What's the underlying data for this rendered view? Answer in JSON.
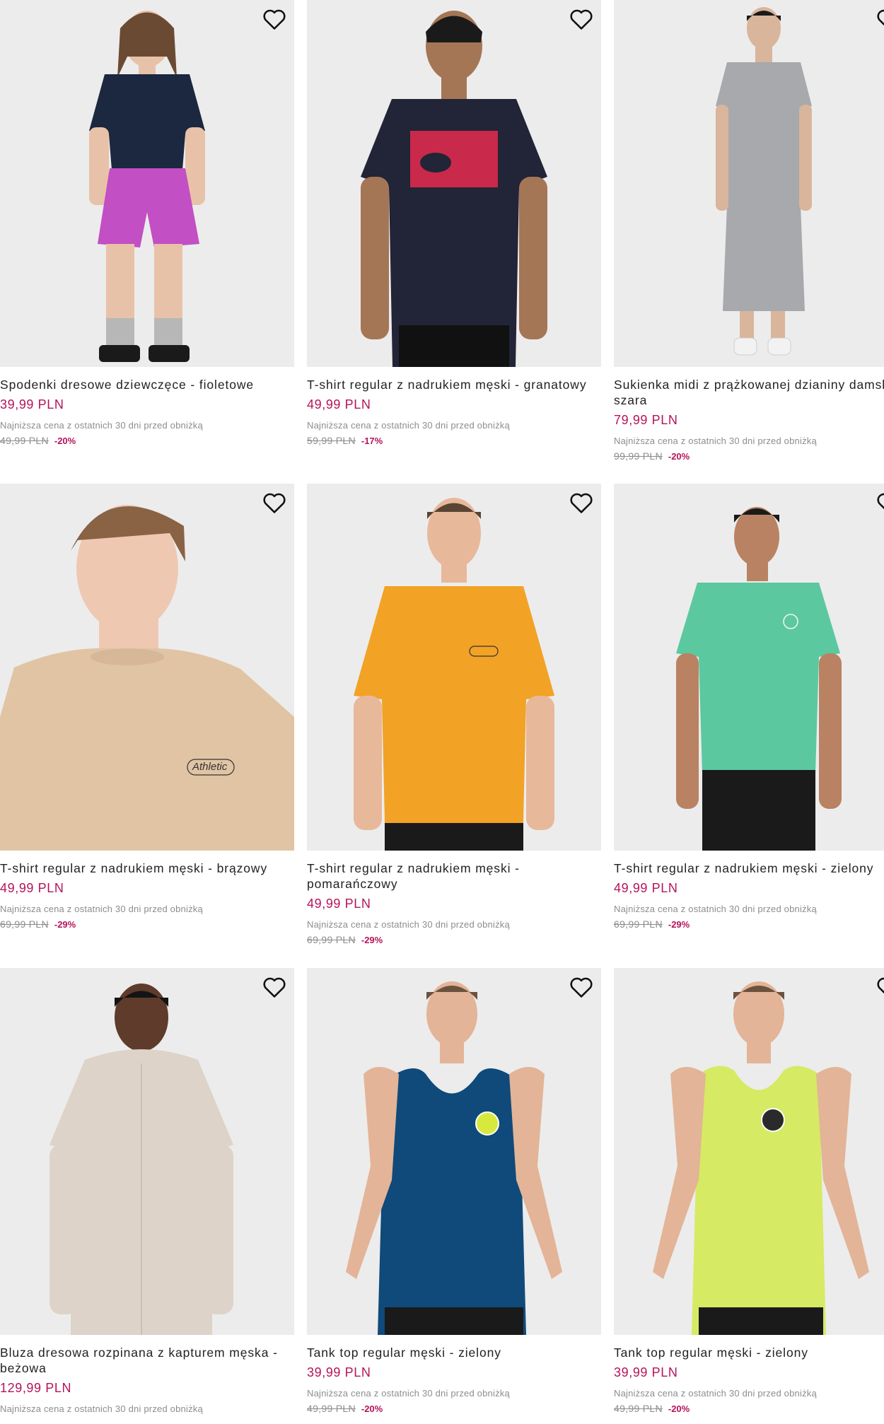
{
  "products": [
    {
      "name": "Spodenki dresowe dziewczęce - fioletowe",
      "price": "39,99 PLN",
      "lowest_note": "Najniższa cena z ostatnich 30 dni przed obniżką",
      "old_price": "49,99 PLN",
      "discount": "-20%",
      "wishlist_icon": "heart-outline-icon"
    },
    {
      "name": "T-shirt regular z nadrukiem męski - granatowy",
      "price": "49,99 PLN",
      "lowest_note": "Najniższa cena z ostatnich 30 dni przed obniżką",
      "old_price": "59,99 PLN",
      "discount": "-17%",
      "wishlist_icon": "heart-outline-icon"
    },
    {
      "name": "Sukienka midi z prążkowanej dzianiny damska - szara",
      "price": "79,99 PLN",
      "lowest_note": "Najniższa cena z ostatnich 30 dni przed obniżką",
      "old_price": "99,99 PLN",
      "discount": "-20%",
      "wishlist_icon": "heart-outline-icon"
    },
    {
      "name": "T-shirt regular z nadrukiem męski - brązowy",
      "price": "49,99 PLN",
      "lowest_note": "Najniższa cena z ostatnich 30 dni przed obniżką",
      "old_price": "69,99 PLN",
      "discount": "-29%",
      "wishlist_icon": "heart-outline-icon"
    },
    {
      "name": "T-shirt regular z nadrukiem męski - pomarańczowy",
      "price": "49,99 PLN",
      "lowest_note": "Najniższa cena z ostatnich 30 dni przed obniżką",
      "old_price": "69,99 PLN",
      "discount": "-29%",
      "wishlist_icon": "heart-outline-icon"
    },
    {
      "name": "T-shirt regular z nadrukiem męski - zielony",
      "price": "49,99 PLN",
      "lowest_note": "Najniższa cena z ostatnich 30 dni przed obniżką",
      "old_price": "69,99 PLN",
      "discount": "-29%",
      "wishlist_icon": "heart-outline-icon"
    },
    {
      "name": "Bluza dresowa rozpinana z kapturem męska - beżowa",
      "price": "129,99 PLN",
      "lowest_note": "Najniższa cena z ostatnich 30 dni przed obniżką",
      "old_price": "",
      "discount": "",
      "wishlist_icon": "heart-outline-icon"
    },
    {
      "name": "Tank top regular męski - zielony",
      "price": "39,99 PLN",
      "lowest_note": "Najniższa cena z ostatnich 30 dni przed obniżką",
      "old_price": "49,99 PLN",
      "discount": "-20%",
      "wishlist_icon": "heart-outline-icon"
    },
    {
      "name": "Tank top regular męski - zielony",
      "price": "39,99 PLN",
      "lowest_note": "Najniższa cena z ostatnich 30 dni przed obniżką",
      "old_price": "49,99 PLN",
      "discount": "-20%",
      "wishlist_icon": "heart-outline-icon"
    }
  ],
  "colors": {
    "price": "#b5135a",
    "image_bg": "#ebebeb",
    "muted": "#8d8d8d",
    "text": "#222222"
  }
}
